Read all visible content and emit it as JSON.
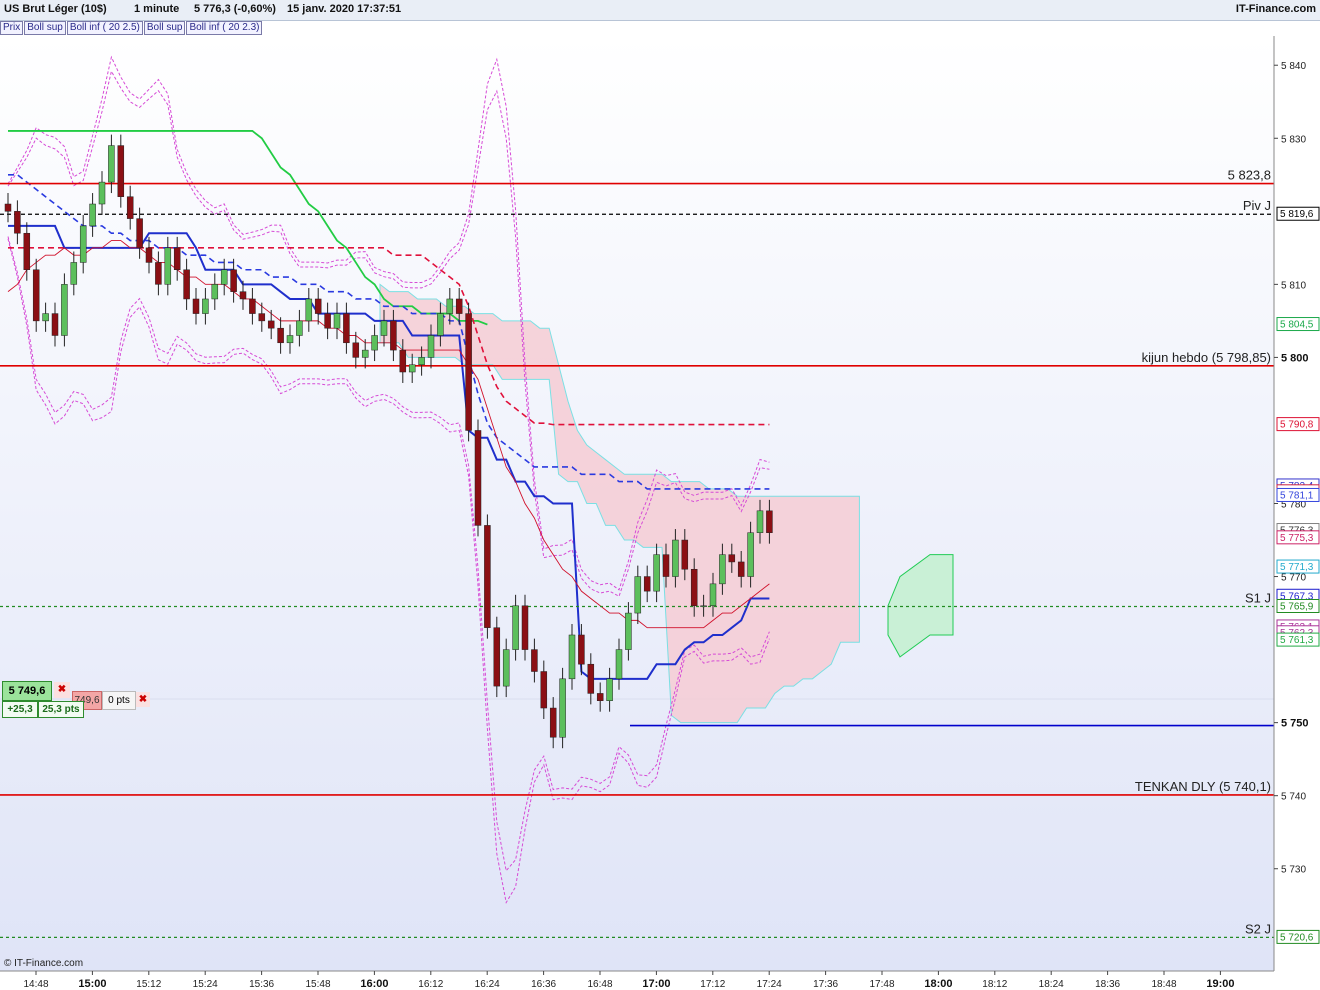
{
  "header": {
    "instrument": "US Brut Léger (10$)",
    "timeframe": "1 minute",
    "price_change": "5 776,3 (-0,60%)",
    "datetime": "15 janv. 2020 17:37:51",
    "brand": "IT-Finance.com"
  },
  "legend": [
    "Prix",
    "Boll sup",
    "Boll inf ( 20 2.5)",
    "Boll sup",
    "Boll inf ( 20 2.3)"
  ],
  "footer": {
    "copyright": "© IT-Finance.com"
  },
  "order_panel": {
    "price": "5 749,6",
    "diff": "+25,3",
    "pts": "25,3 pts",
    "second_price": "749,6",
    "zero_pts": "0 pts"
  },
  "colors": {
    "background_top": "#ffffff",
    "background_bottom": "#dfe4f7",
    "bull_candle": "#5cbf5c",
    "bear_candle": "#8b0f14",
    "support_green": "#00aa44",
    "resistance_red": "#e00000",
    "kijun_blue": "#1f2fcc",
    "bollinger": "#d64bd6",
    "cloud_red": "#f6cdd5",
    "cloud_green": "#c9f0d6"
  },
  "chart_data": {
    "type": "candlestick",
    "ylim": [
      5716,
      5844
    ],
    "x_ticks": [
      "14:48",
      "15:00",
      "15:12",
      "15:24",
      "15:36",
      "15:48",
      "16:00",
      "16:12",
      "16:24",
      "16:36",
      "16:48",
      "17:00",
      "17:12",
      "17:24",
      "17:36",
      "17:48",
      "18:00",
      "18:12",
      "18:24",
      "18:36",
      "18:48",
      "19:00"
    ],
    "x_ticks_bold": [
      "15:00",
      "16:00",
      "17:00",
      "18:00",
      "19:00"
    ],
    "y_ticks": [
      5730,
      5740,
      5750,
      5770,
      5780,
      5800,
      5810,
      5830,
      5840
    ],
    "y_ticks_bold": [
      5750,
      5800
    ],
    "horizontal_lines": [
      {
        "name": "resistance-5823",
        "value": 5823.8,
        "label": "5 823,8",
        "style": "solid",
        "color": "#e00000"
      },
      {
        "name": "pivot-daily",
        "value": 5819.6,
        "label": "Piv J",
        "style": "dashed",
        "color": "#000000"
      },
      {
        "name": "kijun-weekly",
        "value": 5798.85,
        "label": "kijun hebdo (5 798,85)",
        "style": "solid",
        "color": "#e00000"
      },
      {
        "name": "support-s1",
        "value": 5765.9,
        "label": "S1 J",
        "style": "dashed",
        "color": "#228b22"
      },
      {
        "name": "level-5749",
        "value": 5749.6,
        "label": "",
        "style": "solid",
        "color": "#0000cc"
      },
      {
        "name": "tenkan-daily",
        "value": 5740.1,
        "label": "TENKAN DLY (5 740,1)",
        "style": "solid",
        "color": "#e00000"
      },
      {
        "name": "support-s2",
        "value": 5720.6,
        "label": "S2 J",
        "style": "dashed",
        "color": "#228b22"
      }
    ],
    "price_tags": [
      {
        "value": 5819.6,
        "text": "5 819,6",
        "bg": "#ffffff",
        "fg": "#000000",
        "border": "#000000"
      },
      {
        "value": 5804.5,
        "text": "5 804,5",
        "bg": "#ffffff",
        "fg": "#1aa84a",
        "border": "#1aa84a"
      },
      {
        "value": 5790.8,
        "text": "5 790,8",
        "bg": "#ffffff",
        "fg": "#dd1133",
        "border": "#dd1133"
      },
      {
        "value": 5782.4,
        "text": "5 782,4",
        "bg": "#ffffff",
        "fg": "#3333cc",
        "border": "#3333cc"
      },
      {
        "value": 5781.6,
        "text": "5 781,6",
        "bg": "#ffffff",
        "fg": "#cc2244",
        "border": "#cc2244"
      },
      {
        "value": 5781.1,
        "text": "5 781,1",
        "bg": "#ffffff",
        "fg": "#3344dd",
        "border": "#3344dd"
      },
      {
        "value": 5776.3,
        "text": "5 776,3",
        "bg": "#ffd700",
        "fg": "#000000",
        "border": "#000000"
      },
      {
        "value": 5776.3,
        "text": "5 776,3",
        "bg": "#ffffff",
        "fg": "#333333",
        "border": "#888888"
      },
      {
        "value": 5775.3,
        "text": "5 775,3",
        "bg": "#ffffff",
        "fg": "#cc2266",
        "border": "#cc2266"
      },
      {
        "value": 5771.3,
        "text": "5 771,3",
        "bg": "#ffffff",
        "fg": "#22aacc",
        "border": "#22aacc"
      },
      {
        "value": 5767.3,
        "text": "5 767,3",
        "bg": "#ffffff",
        "fg": "#1a1acc",
        "border": "#1a1acc"
      },
      {
        "value": 5765.9,
        "text": "5 765,9",
        "bg": "#ffffff",
        "fg": "#228b22",
        "border": "#228b22"
      },
      {
        "value": 5763.1,
        "text": "5 763,1",
        "bg": "#ffffff",
        "fg": "#aa3399",
        "border": "#aa3399"
      },
      {
        "value": 5762.3,
        "text": "5 762,3",
        "bg": "#ffffff",
        "fg": "#aa3399",
        "border": "#aa3399"
      },
      {
        "value": 5761.3,
        "text": "5 761,3",
        "bg": "#ffffff",
        "fg": "#22aa44",
        "border": "#22aa44"
      },
      {
        "value": 5720.6,
        "text": "5 720,6",
        "bg": "#ffffff",
        "fg": "#228b22",
        "border": "#228b22"
      }
    ],
    "close_series": [
      5820,
      5817,
      5812,
      5805,
      5806,
      5803,
      5810,
      5813,
      5818,
      5821,
      5824,
      5829,
      5822,
      5819,
      5815,
      5813,
      5810,
      5815,
      5812,
      5808,
      5806,
      5808,
      5810,
      5812,
      5809,
      5808,
      5806,
      5805,
      5804,
      5802,
      5803,
      5805,
      5808,
      5806,
      5804,
      5806,
      5802,
      5800,
      5801,
      5803,
      5805,
      5801,
      5798,
      5799,
      5800,
      5803,
      5806,
      5808,
      5806,
      5790,
      5777,
      5763,
      5755,
      5760,
      5766,
      5760,
      5757,
      5752,
      5748,
      5756,
      5762,
      5758,
      5754,
      5753,
      5756,
      5760,
      5765,
      5770,
      5768,
      5773,
      5770,
      5775,
      5771,
      5766,
      5766,
      5769,
      5773,
      5772,
      5770,
      5776,
      5779,
      5776
    ],
    "sma_series": [
      5809,
      5810,
      5812,
      5813,
      5814,
      5814,
      5815,
      5814,
      5814,
      5815,
      5815,
      5816,
      5816,
      5815,
      5815,
      5814,
      5813,
      5813,
      5812,
      5811,
      5811,
      5810,
      5810,
      5810,
      5809,
      5808,
      5808,
      5807,
      5806,
      5805,
      5805,
      5805,
      5805,
      5805,
      5804,
      5804,
      5803,
      5803,
      5802,
      5802,
      5802,
      5802,
      5801,
      5801,
      5801,
      5801,
      5801,
      5801,
      5801,
      5799,
      5797,
      5793,
      5789,
      5785,
      5783,
      5780,
      5778,
      5775,
      5773,
      5771,
      5770,
      5768,
      5767,
      5766,
      5765,
      5765,
      5764,
      5764,
      5763,
      5763,
      5763,
      5763,
      5763,
      5763,
      5763,
      5764,
      5765,
      5765,
      5766,
      5767,
      5768,
      5769
    ],
    "ema_red_dashed": [
      5815,
      5815,
      5815,
      5815,
      5815,
      5815,
      5815,
      5815,
      5815,
      5815,
      5815,
      5815,
      5815,
      5815,
      5815,
      5815,
      5815,
      5815,
      5815,
      5815,
      5815,
      5815,
      5815,
      5815,
      5815,
      5815,
      5815,
      5815,
      5815,
      5815,
      5815,
      5815,
      5815,
      5815,
      5815,
      5815,
      5815,
      5815,
      5815,
      5815,
      5815,
      5814,
      5814,
      5814,
      5814,
      5813,
      5812,
      5811,
      5810,
      5807,
      5803,
      5799,
      5796,
      5794,
      5793,
      5792,
      5791,
      5791,
      5790.8,
      5790.8,
      5790.8,
      5790.8,
      5790.8,
      5790.8,
      5790.8,
      5790.8,
      5790.8,
      5790.8,
      5790.8,
      5790.8,
      5790.8,
      5790.8,
      5790.8,
      5790.8,
      5790.8,
      5790.8,
      5790.8,
      5790.8,
      5790.8,
      5790.8,
      5790.8,
      5790.8
    ],
    "ema_blue_dashed": [
      5825,
      5825,
      5824,
      5823,
      5822,
      5821,
      5820,
      5819,
      5818,
      5818,
      5818,
      5817,
      5817,
      5816,
      5816,
      5816,
      5815,
      5815,
      5815,
      5814,
      5814,
      5814,
      5813,
      5813,
      5813,
      5812,
      5812,
      5812,
      5811,
      5811,
      5811,
      5810,
      5810,
      5810,
      5809,
      5809,
      5809,
      5808,
      5808,
      5808,
      5807,
      5807,
      5807,
      5806,
      5806,
      5806,
      5806,
      5805,
      5805,
      5800,
      5795,
      5791,
      5789,
      5788,
      5787,
      5786,
      5785,
      5785,
      5785,
      5785,
      5785,
      5784,
      5784,
      5784,
      5784,
      5783,
      5783,
      5783,
      5782,
      5782,
      5782,
      5782,
      5782,
      5782,
      5782,
      5782,
      5782,
      5782,
      5782,
      5782,
      5782,
      5782
    ],
    "kijun_solid": [
      5818,
      5818,
      5818,
      5818,
      5818,
      5818,
      5815,
      5815,
      5815,
      5815,
      5815,
      5815,
      5815,
      5815,
      5815,
      5817,
      5817,
      5817,
      5817,
      5817,
      5815,
      5812,
      5812,
      5812,
      5812,
      5810,
      5810,
      5810,
      5810,
      5809,
      5808,
      5808,
      5808,
      5806,
      5806,
      5806,
      5806,
      5806,
      5806,
      5805,
      5805,
      5805,
      5805,
      5803,
      5803,
      5803,
      5803,
      5803,
      5803,
      5790,
      5789,
      5789,
      5786,
      5786,
      5783,
      5783,
      5781,
      5781,
      5780,
      5780,
      5780,
      5757,
      5756,
      5756,
      5756,
      5756,
      5756,
      5756,
      5756,
      5758,
      5758,
      5758,
      5760,
      5761,
      5761,
      5762,
      5762,
      5763,
      5764,
      5767,
      5767,
      5767
    ],
    "ma_long_green": [
      5831,
      5831,
      5831,
      5831,
      5831,
      5831,
      5831,
      5831,
      5831,
      5831,
      5831,
      5831,
      5831,
      5831,
      5831,
      5831,
      5831,
      5831,
      5831,
      5831,
      5831,
      5831,
      5831,
      5831,
      5831,
      5831,
      5831,
      5830,
      5828,
      5826,
      5825,
      5823,
      5821,
      5820,
      5818,
      5816,
      5815,
      5813,
      5811,
      5810,
      5808,
      5807,
      5807,
      5807,
      5806,
      5806,
      5806,
      5806,
      5805,
      5805,
      5805,
      5804.5
    ]
  }
}
